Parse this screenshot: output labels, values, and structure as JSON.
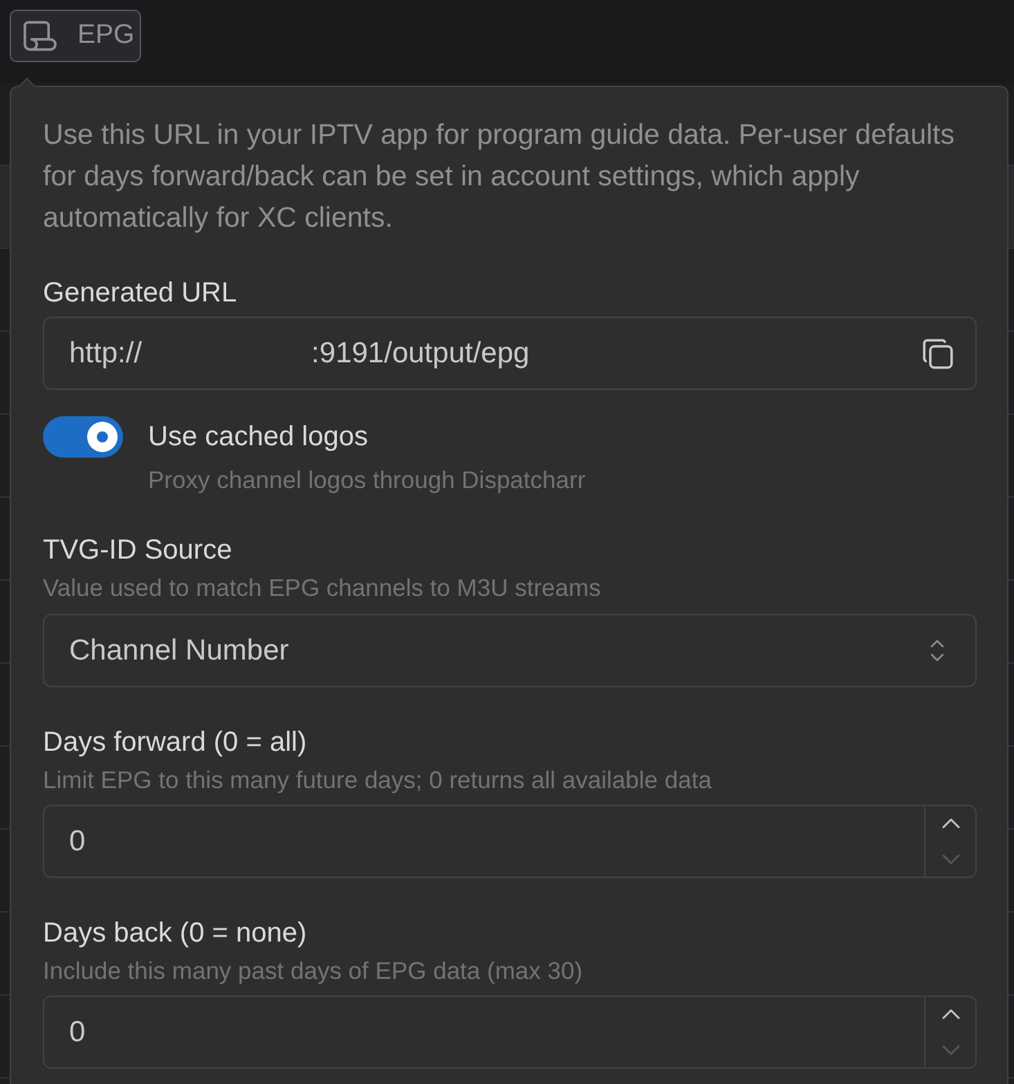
{
  "trigger_button": {
    "label": "EPG"
  },
  "popover": {
    "description": "Use this URL in your IPTV app for program guide data. Per-user defaults for days forward/back can be set in account settings, which apply automatically for XC clients.",
    "generated_url": {
      "label": "Generated URL",
      "value": "http://                     :9191/output/epg"
    },
    "cached_logos": {
      "label": "Use cached logos",
      "description": "Proxy channel logos through Dispatcharr",
      "on": true
    },
    "fields": [
      {
        "kind": "select",
        "label": "TVG-ID Source",
        "description": "Value used to match EPG channels to M3U streams",
        "value": "Channel Number"
      },
      {
        "kind": "number",
        "label": "Days forward (0 = all)",
        "description": "Limit EPG to this many future days; 0 returns all available data",
        "value": "0",
        "decrement_disabled": true
      },
      {
        "kind": "number",
        "label": "Days back (0 = none)",
        "description": "Include this many past days of EPG data (max 30)",
        "value": "0",
        "decrement_disabled": true
      }
    ]
  }
}
